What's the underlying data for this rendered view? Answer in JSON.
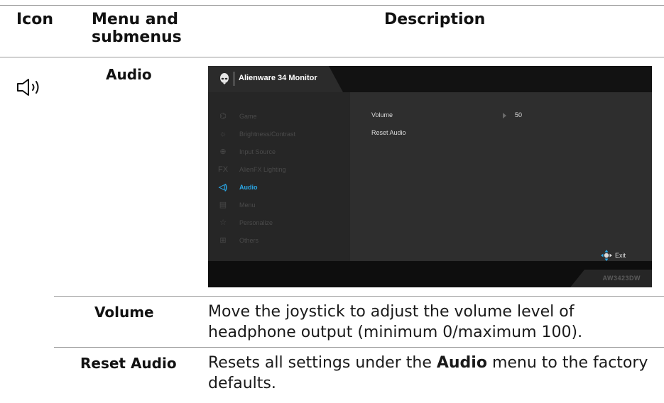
{
  "table": {
    "headers": {
      "icon": "Icon",
      "menu": "Menu and submenus",
      "description": "Description"
    },
    "row": {
      "icon": "speaker-icon",
      "menu_title": "Audio"
    },
    "subrows": [
      {
        "name": "Volume",
        "description": "Move the joystick to adjust the volume level of headphone output (minimum 0/maximum 100)."
      },
      {
        "name": "Reset Audio",
        "description_before": "Resets all settings under the ",
        "description_bold": "Audio",
        "description_after": " menu to the factory defaults."
      }
    ]
  },
  "osd": {
    "title": "Alienware 34 Monitor",
    "model": "AW3423DW",
    "menu_items": [
      {
        "label": "Game",
        "icon": "gamepad-icon",
        "active": false
      },
      {
        "label": "Brightness/Contrast",
        "icon": "brightness-icon",
        "active": false
      },
      {
        "label": "Input Source",
        "icon": "input-icon",
        "active": false
      },
      {
        "label": "AlienFX Lighting",
        "icon": "fx-icon",
        "active": false
      },
      {
        "label": "Audio",
        "icon": "speaker-icon",
        "active": true
      },
      {
        "label": "Menu",
        "icon": "menu-icon",
        "active": false
      },
      {
        "label": "Personalize",
        "icon": "star-icon",
        "active": false
      },
      {
        "label": "Others",
        "icon": "others-icon",
        "active": false
      }
    ],
    "options": [
      {
        "label": "Volume",
        "value": "50"
      },
      {
        "label": "Reset Audio"
      }
    ],
    "exit_label": "Exit",
    "accent_color": "#2aa7e6"
  }
}
